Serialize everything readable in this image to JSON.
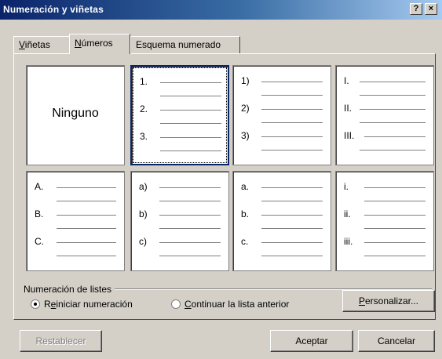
{
  "window": {
    "title": "Numeración y viñetas",
    "help_label": "?",
    "close_label": "×"
  },
  "tabs": [
    {
      "label": "Viñetas",
      "accel": "V",
      "rest": "iñetas",
      "active": false
    },
    {
      "label": "Números",
      "accel": "N",
      "rest": "úmeros",
      "active": true
    },
    {
      "label": "Esquema numerado",
      "accel": "",
      "rest": "Esquema numerado",
      "active": false
    }
  ],
  "options": {
    "none": "Ninguno",
    "r1c2": [
      "1.",
      "2.",
      "3."
    ],
    "r1c3": [
      "1)",
      "2)",
      "3)"
    ],
    "r1c4": [
      "I.",
      "II.",
      "III."
    ],
    "r2c1": [
      "A.",
      "B.",
      "C."
    ],
    "r2c2": [
      "a)",
      "b)",
      "c)"
    ],
    "r2c3": [
      "a.",
      "b.",
      "c."
    ],
    "r2c4": [
      "i.",
      "ii.",
      "iii."
    ],
    "selected": "r1c2"
  },
  "list_numbering": {
    "group_label": "Numeración de listes",
    "restart": {
      "accel": "e",
      "pre": "R",
      "post": "iniciar numeración",
      "checked": true
    },
    "continue": {
      "accel": "C",
      "post": "ontinuar la lista anterior",
      "checked": false
    }
  },
  "buttons": {
    "customize": {
      "accel": "P",
      "rest": "ersonalizar..."
    },
    "reset": "Restablecer",
    "ok": "Aceptar",
    "cancel": "Cancelar"
  }
}
